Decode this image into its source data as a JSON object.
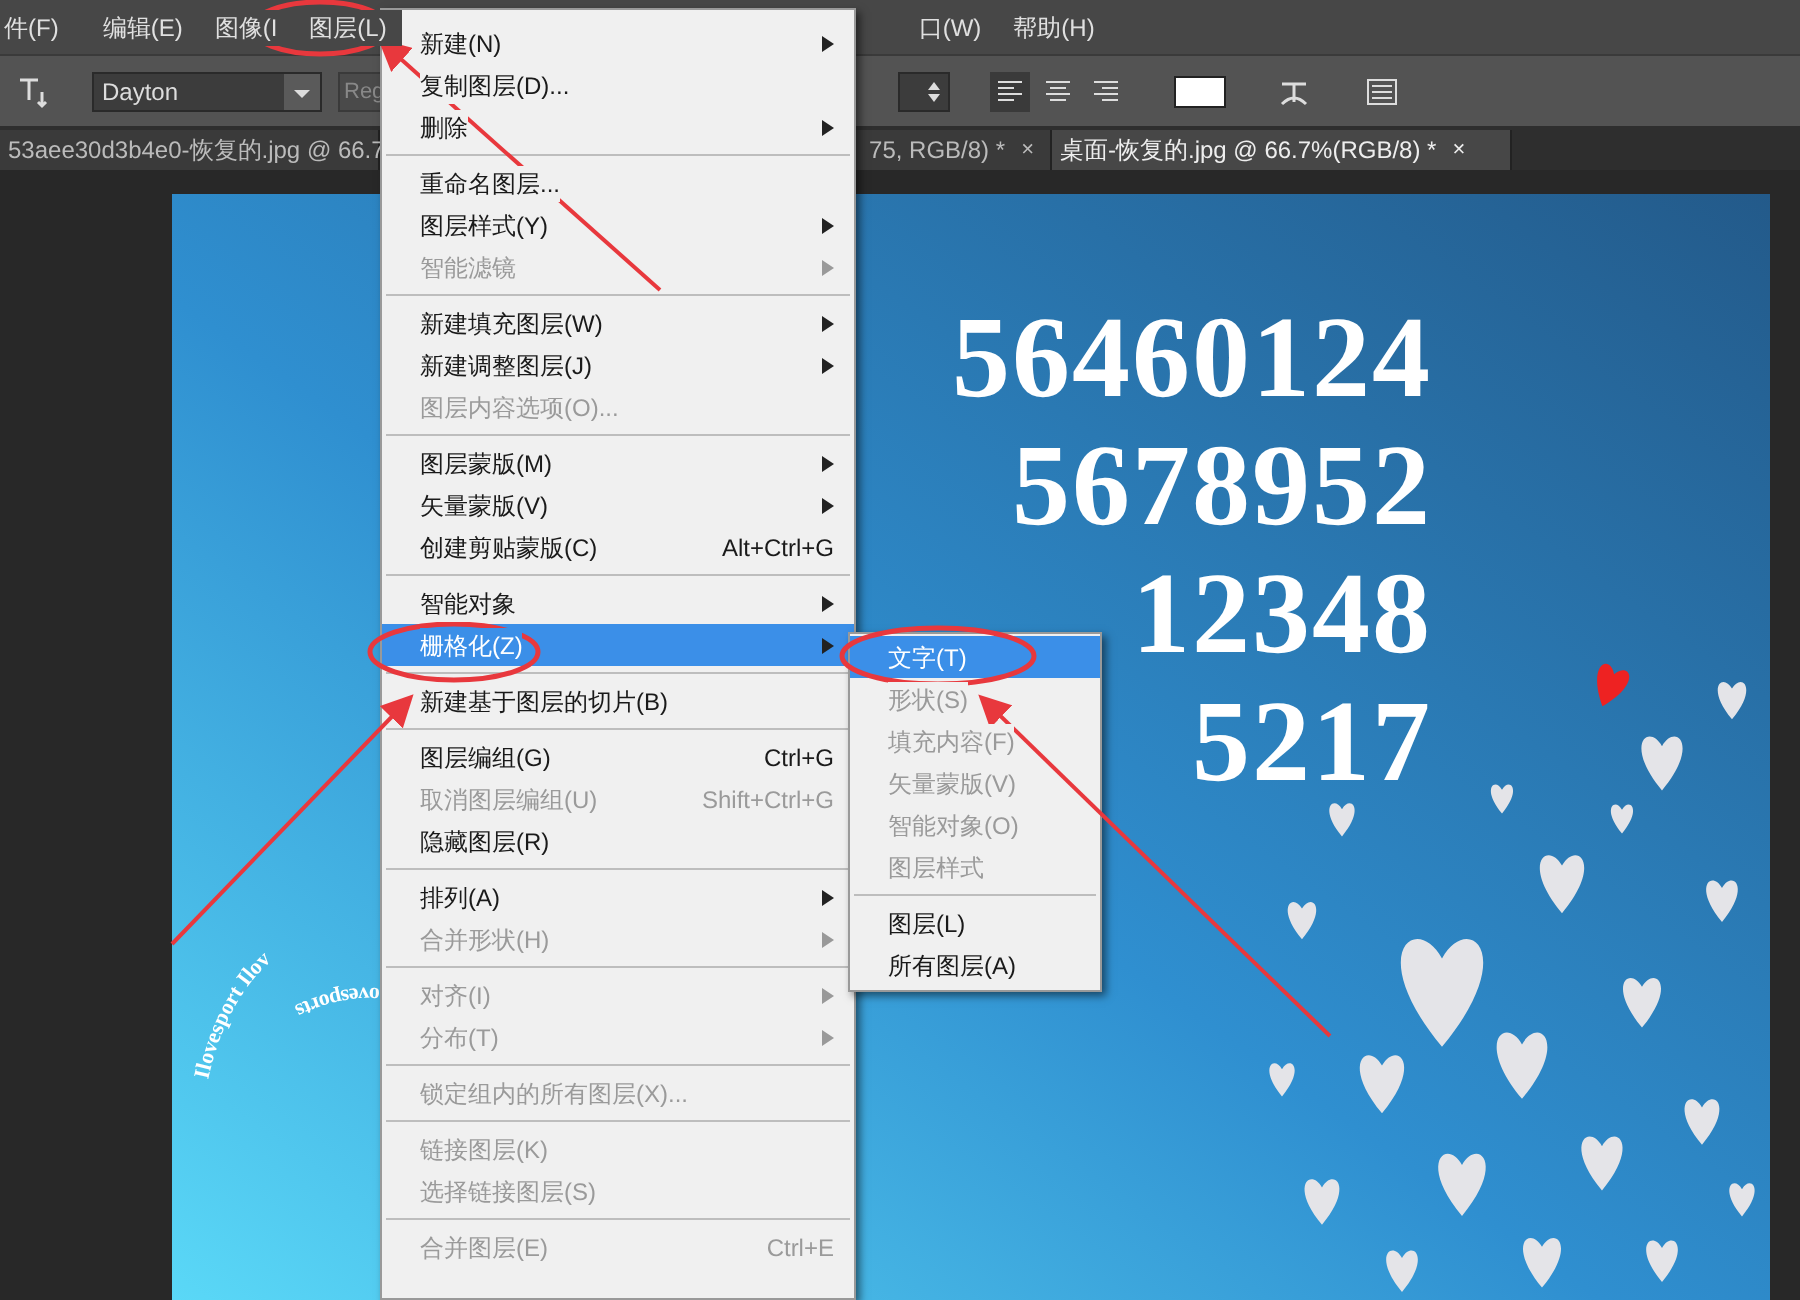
{
  "menu_bar": [
    {
      "label": "件(F)"
    },
    {
      "label": "编辑(E)"
    },
    {
      "label": "图像(I"
    },
    {
      "label": "图层(L)"
    },
    {
      "label": "口(W)"
    },
    {
      "label": "帮助(H)"
    }
  ],
  "options_bar": {
    "font_family": "Dayton",
    "font_style": "Reg"
  },
  "document_tabs": [
    {
      "label": "53aee30d3b4e0-恢复的.jpg @ 66.7",
      "selected": false
    },
    {
      "label": "75, RGB/8) *",
      "close": "×",
      "selected": false
    },
    {
      "label": "桌面-恢复的.jpg @ 66.7%(RGB/8) *",
      "close": "×",
      "selected": true
    }
  ],
  "canvas": {
    "number_lines": [
      "56460124",
      "5678952",
      "12348",
      "5217"
    ],
    "curved_text": [
      "Ilovesport Ilov",
      "ovesports"
    ]
  },
  "layer_menu": [
    {
      "kind": "item",
      "label": "新建(N)",
      "submenu": true,
      "disabled": false,
      "selected": false
    },
    {
      "kind": "item",
      "label": "复制图层(D)...",
      "submenu": false,
      "disabled": false,
      "selected": false
    },
    {
      "kind": "item",
      "label": "删除",
      "submenu": true,
      "disabled": false,
      "selected": false
    },
    {
      "kind": "separator"
    },
    {
      "kind": "item",
      "label": "重命名图层...",
      "submenu": false,
      "disabled": false,
      "selected": false
    },
    {
      "kind": "item",
      "label": "图层样式(Y)",
      "submenu": true,
      "disabled": false,
      "selected": false
    },
    {
      "kind": "item",
      "label": "智能滤镜",
      "submenu": true,
      "disabled": true,
      "selected": false
    },
    {
      "kind": "separator"
    },
    {
      "kind": "item",
      "label": "新建填充图层(W)",
      "submenu": true,
      "disabled": false,
      "selected": false
    },
    {
      "kind": "item",
      "label": "新建调整图层(J)",
      "submenu": true,
      "disabled": false,
      "selected": false
    },
    {
      "kind": "item",
      "label": "图层内容选项(O)...",
      "submenu": false,
      "disabled": true,
      "selected": false
    },
    {
      "kind": "separator"
    },
    {
      "kind": "item",
      "label": "图层蒙版(M)",
      "submenu": true,
      "disabled": false,
      "selected": false
    },
    {
      "kind": "item",
      "label": "矢量蒙版(V)",
      "submenu": true,
      "disabled": false,
      "selected": false
    },
    {
      "kind": "item",
      "label": "创建剪贴蒙版(C)",
      "shortcut": "Alt+Ctrl+G",
      "submenu": false,
      "disabled": false,
      "selected": false
    },
    {
      "kind": "separator"
    },
    {
      "kind": "item",
      "label": "智能对象",
      "submenu": true,
      "disabled": false,
      "selected": false
    },
    {
      "kind": "item",
      "label": "栅格化(Z)",
      "submenu": true,
      "disabled": false,
      "selected": true
    },
    {
      "kind": "separator"
    },
    {
      "kind": "item",
      "label": "新建基于图层的切片(B)",
      "submenu": false,
      "disabled": false,
      "selected": false
    },
    {
      "kind": "separator"
    },
    {
      "kind": "item",
      "label": "图层编组(G)",
      "shortcut": "Ctrl+G",
      "submenu": false,
      "disabled": false,
      "selected": false
    },
    {
      "kind": "item",
      "label": "取消图层编组(U)",
      "shortcut": "Shift+Ctrl+G",
      "submenu": false,
      "disabled": true,
      "selected": false
    },
    {
      "kind": "item",
      "label": "隐藏图层(R)",
      "submenu": false,
      "disabled": false,
      "selected": false
    },
    {
      "kind": "separator"
    },
    {
      "kind": "item",
      "label": "排列(A)",
      "submenu": true,
      "disabled": false,
      "selected": false
    },
    {
      "kind": "item",
      "label": "合并形状(H)",
      "submenu": true,
      "disabled": true,
      "selected": false
    },
    {
      "kind": "separator"
    },
    {
      "kind": "item",
      "label": "对齐(I)",
      "submenu": true,
      "disabled": true,
      "selected": false
    },
    {
      "kind": "item",
      "label": "分布(T)",
      "submenu": true,
      "disabled": true,
      "selected": false
    },
    {
      "kind": "separator"
    },
    {
      "kind": "item",
      "label": "锁定组内的所有图层(X)...",
      "submenu": false,
      "disabled": true,
      "selected": false
    },
    {
      "kind": "separator"
    },
    {
      "kind": "item",
      "label": "链接图层(K)",
      "submenu": false,
      "disabled": true,
      "selected": false
    },
    {
      "kind": "item",
      "label": "选择链接图层(S)",
      "submenu": false,
      "disabled": true,
      "selected": false
    },
    {
      "kind": "separator"
    },
    {
      "kind": "item",
      "label": "合并图层(E)",
      "shortcut": "Ctrl+E",
      "submenu": false,
      "disabled": true,
      "selected": false
    }
  ],
  "rasterize_submenu": [
    {
      "kind": "item",
      "label": "文字(T)",
      "disabled": false,
      "selected": true
    },
    {
      "kind": "item",
      "label": "形状(S)",
      "disabled": true,
      "selected": false
    },
    {
      "kind": "item",
      "label": "填充内容(F)",
      "disabled": true,
      "selected": false
    },
    {
      "kind": "item",
      "label": "矢量蒙版(V)",
      "disabled": true,
      "selected": false
    },
    {
      "kind": "item",
      "label": "智能对象(O)",
      "disabled": true,
      "selected": false
    },
    {
      "kind": "item",
      "label": "图层样式",
      "disabled": true,
      "selected": false
    },
    {
      "kind": "separator"
    },
    {
      "kind": "item",
      "label": "图层(L)",
      "disabled": false,
      "selected": false
    },
    {
      "kind": "item",
      "label": "所有图层(A)",
      "disabled": false,
      "selected": false
    }
  ]
}
